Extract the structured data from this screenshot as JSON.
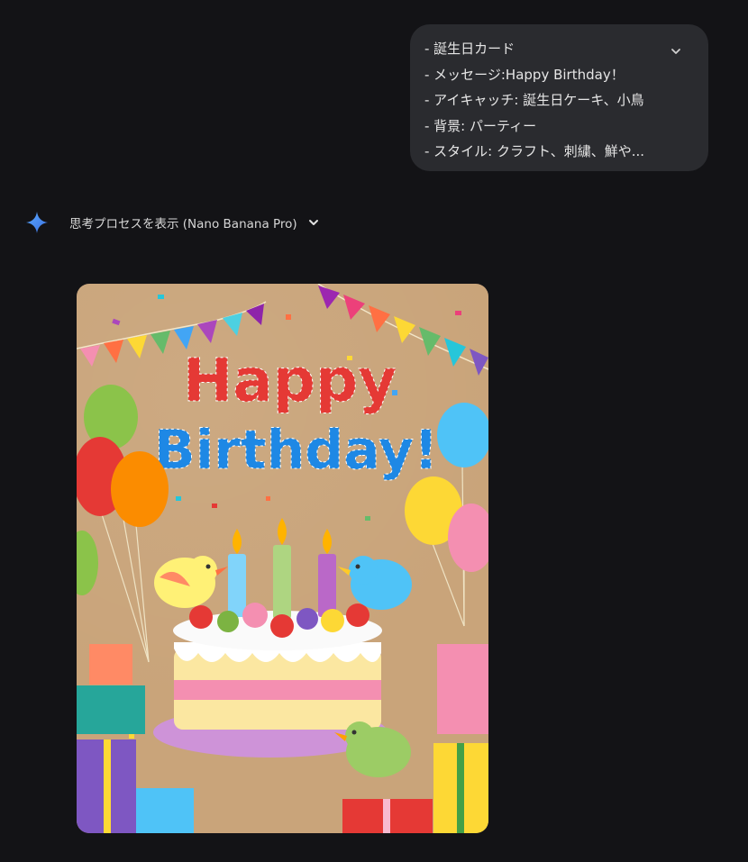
{
  "user_message": {
    "lines": [
      "- 誕生日カード",
      "- メッセージ:Happy Birthday！",
      "- アイキャッチ: 誕生日ケーキ、小鳥",
      "- 背景: パーティー",
      "- スタイル: クラフト、刺繍、鮮や..."
    ],
    "expand_icon": "chevron-down-icon"
  },
  "response": {
    "assistant_icon": "sparkle-icon",
    "thinking_label": "思考プロセスを表示 (Nano Banana Pro)",
    "thinking_icon": "chevron-down-icon"
  },
  "generated_image": {
    "headline_line1": "Happy",
    "headline_line2": "Birthday!"
  },
  "colors": {
    "background": "#131316",
    "bubble": "#2a2b2f",
    "text": "#e3e3e3",
    "sparkle": "#4a8cf7",
    "card_background": "#c9a47a"
  }
}
